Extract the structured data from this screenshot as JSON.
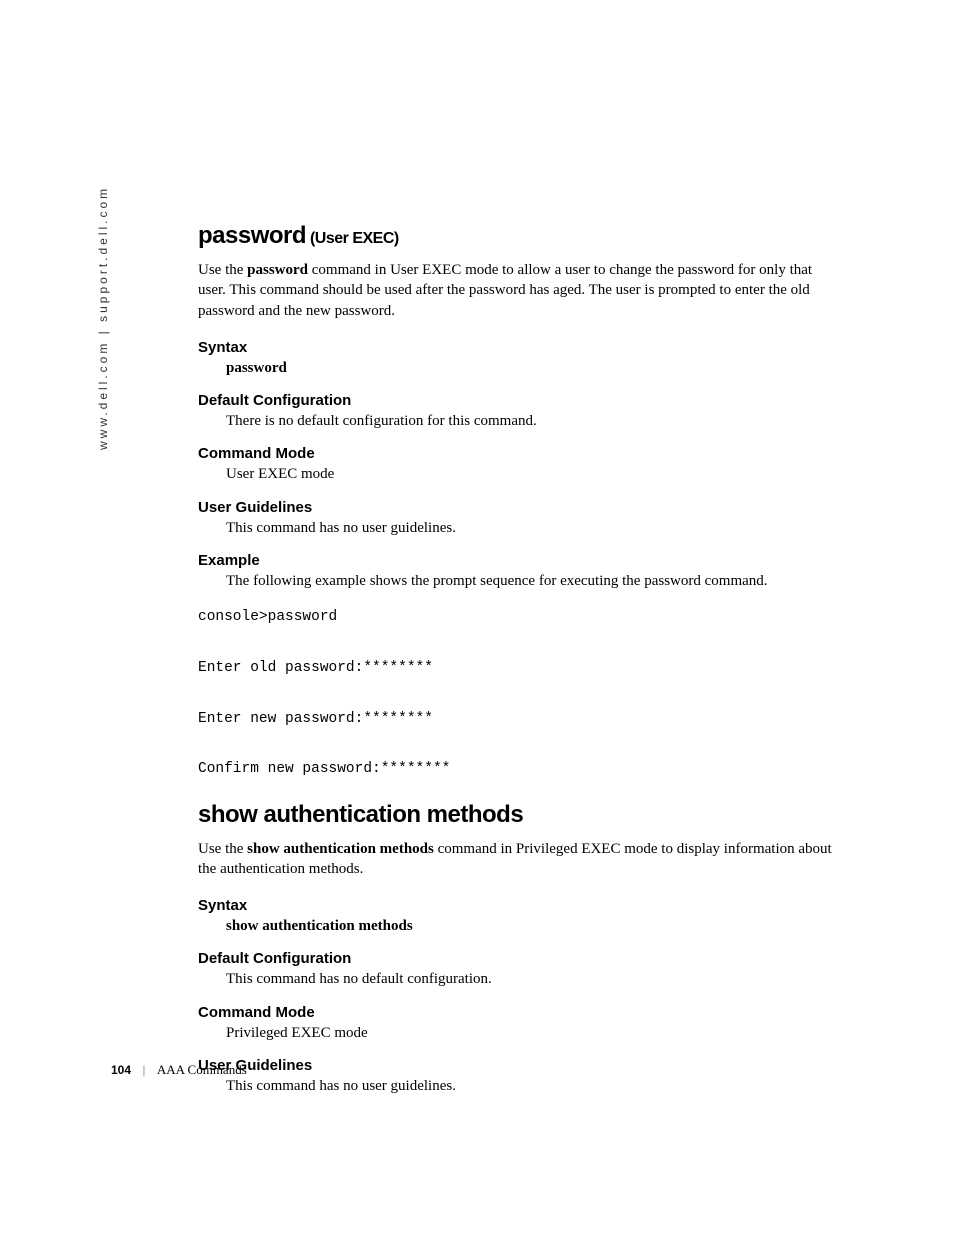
{
  "sidebar": "www.dell.com | support.dell.com",
  "sec1": {
    "title_main": "password",
    "title_sub": " (User EXEC)",
    "intro_pre": "Use the ",
    "intro_bold": "password",
    "intro_post": " command in User EXEC mode to allow a user to change the password for only that user. This command should be used after the password has aged. The user is prompted to enter the old password and the new password.",
    "syntax_label": "Syntax",
    "syntax_body": "password",
    "defconf_label": "Default Configuration",
    "defconf_body": "There is no default configuration for this command.",
    "cmdmode_label": "Command Mode",
    "cmdmode_body": "User EXEC mode",
    "userg_label": "User Guidelines",
    "userg_body": "This command has no user guidelines.",
    "example_label": "Example",
    "example_body": "The following example shows the prompt sequence for executing the password command.",
    "console": "console>password\n\nEnter old password:********\n\nEnter new password:********\n\nConfirm new password:********"
  },
  "sec2": {
    "title": "show authentication methods",
    "intro_pre": "Use the ",
    "intro_bold": "show authentication methods",
    "intro_post": " command in Privileged EXEC mode to display information about the authentication methods.",
    "syntax_label": "Syntax",
    "syntax_body": "show authentication methods",
    "defconf_label": "Default Configuration",
    "defconf_body": "This command has no default configuration.",
    "cmdmode_label": "Command Mode",
    "cmdmode_body": "Privileged EXEC mode",
    "userg_label": "User Guidelines",
    "userg_body": "This command has no user guidelines."
  },
  "footer": {
    "page": "104",
    "section": "AAA Commands"
  }
}
